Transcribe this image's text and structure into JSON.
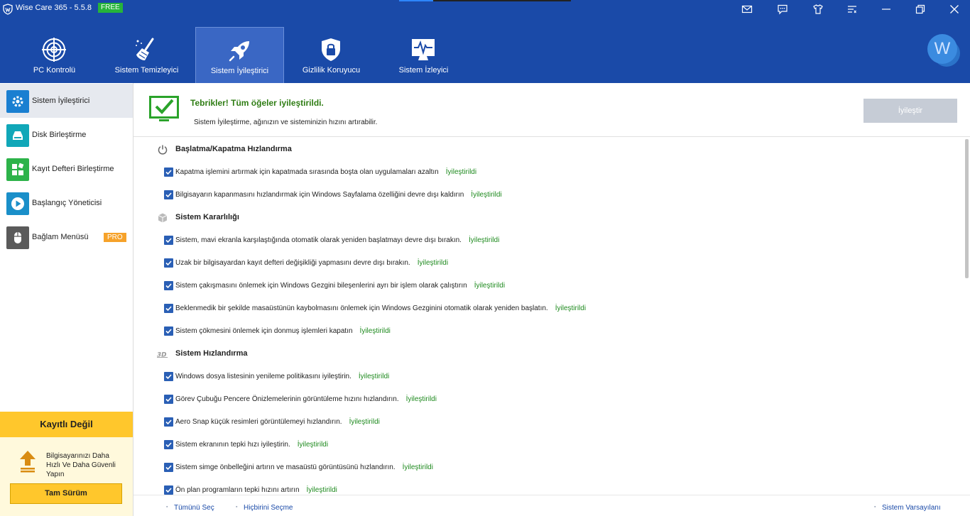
{
  "titlebar": {
    "title": "Wise Care 365 - 5.5.8",
    "badge": "FREE",
    "icons": [
      "mail-icon",
      "chat-icon",
      "tshirt-icon",
      "menu-icon",
      "minimize-icon",
      "restore-icon",
      "close-icon"
    ]
  },
  "nav": {
    "tabs": [
      {
        "label": "PC Kontrolü",
        "icon": "radar-icon"
      },
      {
        "label": "Sistem Temizleyici",
        "icon": "broom-icon"
      },
      {
        "label": "Sistem İyileştirici",
        "icon": "rocket-icon",
        "active": true
      },
      {
        "label": "Gizlilik Koruyucu",
        "icon": "lock-shield-icon"
      },
      {
        "label": "Sistem İzleyici",
        "icon": "monitor-pulse-icon"
      }
    ],
    "avatar_letter": "W"
  },
  "sidebar": {
    "items": [
      {
        "label": "Sistem İyileştirici",
        "icon": "gear-icon",
        "color": "#1a7fd1",
        "active": true
      },
      {
        "label": "Disk Birleştirme",
        "icon": "disk-icon",
        "color": "#10a7b8"
      },
      {
        "label": "Kayıt Defteri Birleştirme",
        "icon": "registry-icon",
        "color": "#2db34a"
      },
      {
        "label": "Başlangıç Yöneticisi",
        "icon": "play-icon",
        "color": "#1a8fc9"
      },
      {
        "label": "Bağlam Menüsü",
        "icon": "mouse-icon",
        "color": "#5a5a5a"
      }
    ],
    "pro_badge": "PRO",
    "register": {
      "banner": "Kayıtlı Değil",
      "desc": "Bilgisayarınızı Daha Hızlı Ve Daha Güvenli Yapın",
      "button": "Tam Sürüm"
    }
  },
  "main": {
    "banner": {
      "title": "Tebrikler! Tüm öğeler iyileştirildi.",
      "subtitle": "Sistem İyileştirme, ağınızın ve sisteminizin hızını artırabilir.",
      "button": "İyileştir"
    },
    "sections": [
      {
        "title": "Başlatma/Kapatma Hızlandırma",
        "icon": "power-icon",
        "items": [
          {
            "text": "Kapatma işlemini artırmak için kapatmada sırasında boşta olan uygulamaları azaltın",
            "status": "İyileştirildi"
          },
          {
            "text": "Bilgisayarın kapanmasını hızlandırmak için Windows Sayfalama özelliğini devre dışı kaldırın",
            "status": "İyileştirildi"
          }
        ]
      },
      {
        "title": "Sistem Kararlılığı",
        "icon": "cube-icon",
        "items": [
          {
            "text": "Sistem, mavi ekranla karşılaştığında otomatik olarak yeniden başlatmayı devre dışı bırakın.",
            "status": "İyileştirildi"
          },
          {
            "text": "Uzak bir bilgisayardan kayıt defteri değişikliği yapmasını devre dışı bırakın.",
            "status": "İyileştirildi"
          },
          {
            "text": "Sistem çakışmasını önlemek için Windows Gezgini bileşenlerini ayrı bir işlem olarak çalıştırın",
            "status": "İyileştirildi"
          },
          {
            "text": "Beklenmedik bir şekilde masaüstünün kaybolmasını önlemek için Windows Gezginini otomatik olarak yeniden başlatın.",
            "status": "İyileştirildi"
          },
          {
            "text": "Sistem çökmesini önlemek için donmuş işlemleri kapatın",
            "status": "İyileştirildi"
          }
        ]
      },
      {
        "title": "Sistem Hızlandırma",
        "icon": "3d-icon",
        "items": [
          {
            "text": "Windows dosya listesinin yenileme politikasını iyileştirin.",
            "status": "İyileştirildi"
          },
          {
            "text": "Görev Çubuğu Pencere Önizlemelerinin görüntüleme hızını hızlandırın.",
            "status": "İyileştirildi"
          },
          {
            "text": "Aero Snap küçük resimleri görüntülemeyi hızlandırın.",
            "status": "İyileştirildi"
          },
          {
            "text": "Sistem ekranının tepki hızı iyileştirin.",
            "status": "İyileştirildi"
          },
          {
            "text": "Sistem simge önbelleğini artırın ve masaüstü görüntüsünü hızlandırın.",
            "status": "İyileştirildi"
          },
          {
            "text": "Ön plan programların tepki hızını artırın",
            "status": "İyileştirildi"
          }
        ]
      }
    ],
    "footer": {
      "select_all": "Tümünü Seç",
      "select_none": "Hiçbirini Seçme",
      "defaults": "Sistem Varsayılanı"
    }
  }
}
